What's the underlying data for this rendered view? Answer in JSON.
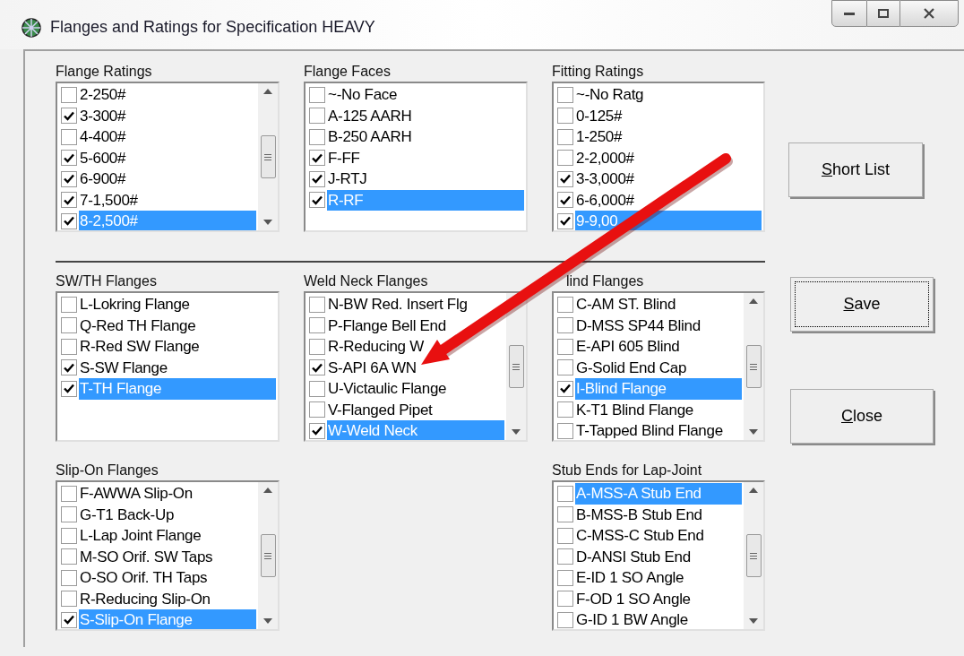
{
  "window": {
    "title": "Flanges and Ratings for Specification HEAVY"
  },
  "lists": [
    {
      "title": "Flange Ratings",
      "scrollbar": true,
      "items": [
        {
          "label": "2-250#",
          "checked": false,
          "selected": false
        },
        {
          "label": "3-300#",
          "checked": true,
          "selected": false
        },
        {
          "label": "4-400#",
          "checked": false,
          "selected": false
        },
        {
          "label": "5-600#",
          "checked": true,
          "selected": false
        },
        {
          "label": "6-900#",
          "checked": true,
          "selected": false
        },
        {
          "label": "7-1,500#",
          "checked": true,
          "selected": false
        },
        {
          "label": "8-2,500#",
          "checked": true,
          "selected": true
        }
      ]
    },
    {
      "title": "Flange Faces",
      "scrollbar": false,
      "items": [
        {
          "label": "~-No Face",
          "checked": false,
          "selected": false
        },
        {
          "label": "A-125 AARH",
          "checked": false,
          "selected": false
        },
        {
          "label": "B-250 AARH",
          "checked": false,
          "selected": false
        },
        {
          "label": "F-FF",
          "checked": true,
          "selected": false
        },
        {
          "label": "J-RTJ",
          "checked": true,
          "selected": false
        },
        {
          "label": "R-RF",
          "checked": true,
          "selected": true
        }
      ]
    },
    {
      "title": "Fitting Ratings",
      "scrollbar": false,
      "items": [
        {
          "label": "~-No Ratg",
          "checked": false,
          "selected": false
        },
        {
          "label": "0-125#",
          "checked": false,
          "selected": false
        },
        {
          "label": "1-250#",
          "checked": false,
          "selected": false
        },
        {
          "label": "2-2,000#",
          "checked": false,
          "selected": false
        },
        {
          "label": "3-3,000#",
          "checked": true,
          "selected": false
        },
        {
          "label": "6-6,000#",
          "checked": true,
          "selected": false
        },
        {
          "label": "9-9,00",
          "checked": true,
          "selected": true
        }
      ]
    },
    {
      "title": "SW/TH Flanges",
      "scrollbar": false,
      "items": [
        {
          "label": "L-Lokring Flange",
          "checked": false,
          "selected": false
        },
        {
          "label": "Q-Red TH Flange",
          "checked": false,
          "selected": false
        },
        {
          "label": "R-Red SW Flange",
          "checked": false,
          "selected": false
        },
        {
          "label": "S-SW Flange",
          "checked": true,
          "selected": false
        },
        {
          "label": "T-TH Flange",
          "checked": true,
          "selected": true
        }
      ]
    },
    {
      "title": "Weld Neck Flanges",
      "scrollbar": true,
      "scroll_up_hidden": true,
      "items": [
        {
          "label": "N-BW Red. Insert Flg",
          "checked": false,
          "selected": false
        },
        {
          "label": "P-Flange Bell End",
          "checked": false,
          "selected": false
        },
        {
          "label": "R-Reducing W",
          "checked": false,
          "selected": false
        },
        {
          "label": "S-API 6A WN",
          "checked": true,
          "selected": false
        },
        {
          "label": "U-Victaulic Flange",
          "checked": false,
          "selected": false
        },
        {
          "label": "V-Flanged Pipet",
          "checked": false,
          "selected": false
        },
        {
          "label": "W-Weld Neck",
          "checked": true,
          "selected": true
        }
      ]
    },
    {
      "title": "lind Flanges",
      "title_partly_hidden": true,
      "scrollbar": true,
      "items": [
        {
          "label": "C-AM ST. Blind",
          "checked": false,
          "selected": false
        },
        {
          "label": "D-MSS SP44 Blind",
          "checked": false,
          "selected": false
        },
        {
          "label": "E-API 605 Blind",
          "checked": false,
          "selected": false
        },
        {
          "label": "G-Solid End Cap",
          "checked": false,
          "selected": false
        },
        {
          "label": "I-Blind Flange",
          "checked": true,
          "selected": true
        },
        {
          "label": "K-T1 Blind Flange",
          "checked": false,
          "selected": false
        },
        {
          "label": "T-Tapped Blind Flange",
          "checked": false,
          "selected": false
        }
      ]
    },
    {
      "title": "Slip-On Flanges",
      "scrollbar": true,
      "items": [
        {
          "label": "F-AWWA Slip-On",
          "checked": false,
          "selected": false
        },
        {
          "label": "G-T1 Back-Up",
          "checked": false,
          "selected": false
        },
        {
          "label": "L-Lap Joint Flange",
          "checked": false,
          "selected": false
        },
        {
          "label": "M-SO Orif. SW Taps",
          "checked": false,
          "selected": false
        },
        {
          "label": "O-SO Orif. TH Taps",
          "checked": false,
          "selected": false
        },
        {
          "label": "R-Reducing Slip-On",
          "checked": false,
          "selected": false
        },
        {
          "label": "S-Slip-On Flange",
          "checked": true,
          "selected": true
        }
      ]
    },
    {
      "title": "Stub Ends for Lap-Joint",
      "scrollbar": true,
      "items": [
        {
          "label": "A-MSS-A Stub End",
          "checked": false,
          "selected": true
        },
        {
          "label": "B-MSS-B Stub End",
          "checked": false,
          "selected": false
        },
        {
          "label": "C-MSS-C Stub End",
          "checked": false,
          "selected": false
        },
        {
          "label": "D-ANSI Stub End",
          "checked": false,
          "selected": false
        },
        {
          "label": "E-ID 1 SO Angle",
          "checked": false,
          "selected": false
        },
        {
          "label": "F-OD 1 SO Angle",
          "checked": false,
          "selected": false
        },
        {
          "label": "G-ID 1 BW Angle",
          "checked": false,
          "selected": false
        }
      ]
    }
  ],
  "buttons": [
    {
      "label": "Short List",
      "mnemonic_underlined": true,
      "focused": false
    },
    {
      "label": "Save",
      "mnemonic_underlined": true,
      "focused": true
    },
    {
      "label": "Close",
      "mnemonic_underlined": true,
      "focused": false
    }
  ]
}
